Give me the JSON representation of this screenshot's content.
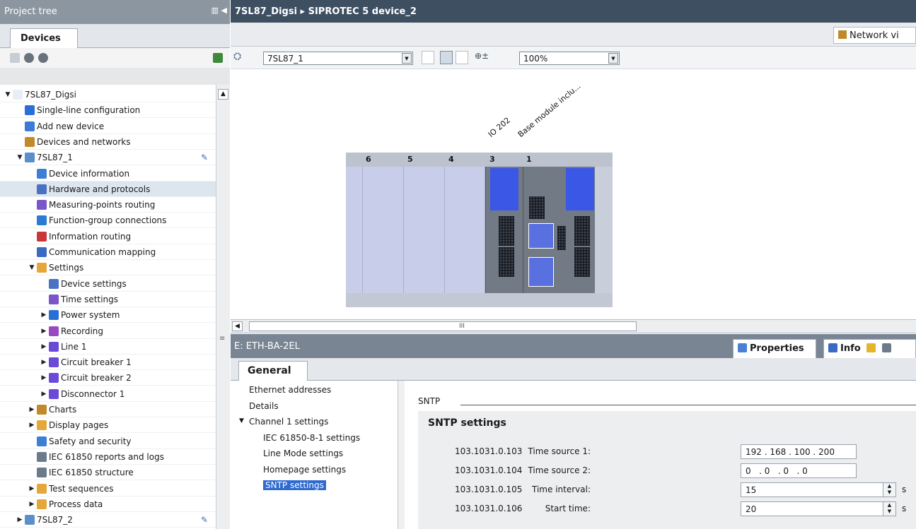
{
  "project_tree": {
    "title": "Project tree",
    "tab": "Devices",
    "items": [
      {
        "label": "7SL87_Digsi",
        "arrow": "▼",
        "indent": 0,
        "icon_color": "#e8eef5"
      },
      {
        "label": "Single-line configuration",
        "arrow": "",
        "indent": 1,
        "icon_color": "#2a6fd6"
      },
      {
        "label": "Add new device",
        "arrow": "",
        "indent": 1,
        "icon_color": "#3a7bd5"
      },
      {
        "label": "Devices and networks",
        "arrow": "",
        "indent": 1,
        "icon_color": "#c08a2a"
      },
      {
        "label": "7SL87_1",
        "arrow": "▼",
        "indent": 1,
        "icon_color": "#5b8fc9",
        "pencil": true
      },
      {
        "label": "Device information",
        "arrow": "",
        "indent": 2,
        "icon_color": "#3e7fd6"
      },
      {
        "label": "Hardware and protocols",
        "arrow": "",
        "indent": 2,
        "icon_color": "#4a72c2",
        "highlight": true
      },
      {
        "label": "Measuring-points routing",
        "arrow": "",
        "indent": 2,
        "icon_color": "#7a56c9"
      },
      {
        "label": "Function-group connections",
        "arrow": "",
        "indent": 2,
        "icon_color": "#2a7bd6"
      },
      {
        "label": "Information routing",
        "arrow": "",
        "indent": 2,
        "icon_color": "#c8383b"
      },
      {
        "label": "Communication mapping",
        "arrow": "",
        "indent": 2,
        "icon_color": "#3a6ac2"
      },
      {
        "label": "Settings",
        "arrow": "▼",
        "indent": 2,
        "icon_color": "#e6a73a"
      },
      {
        "label": "Device settings",
        "arrow": "",
        "indent": 3,
        "icon_color": "#4a72c2"
      },
      {
        "label": "Time settings",
        "arrow": "",
        "indent": 3,
        "icon_color": "#7a56c9"
      },
      {
        "label": "Power system",
        "arrow": "▶",
        "indent": 3,
        "icon_color": "#2a6fd6"
      },
      {
        "label": "Recording",
        "arrow": "▶",
        "indent": 3,
        "icon_color": "#9a4ac0"
      },
      {
        "label": "Line 1",
        "arrow": "▶",
        "indent": 3,
        "icon_color": "#6a4ad6"
      },
      {
        "label": "Circuit breaker 1",
        "arrow": "▶",
        "indent": 3,
        "icon_color": "#6a4ad6"
      },
      {
        "label": "Circuit breaker 2",
        "arrow": "▶",
        "indent": 3,
        "icon_color": "#6a4ad6"
      },
      {
        "label": "Disconnector 1",
        "arrow": "▶",
        "indent": 3,
        "icon_color": "#6a4ad6"
      },
      {
        "label": "Charts",
        "arrow": "▶",
        "indent": 2,
        "icon_color": "#c08a2a"
      },
      {
        "label": "Display pages",
        "arrow": "▶",
        "indent": 2,
        "icon_color": "#e6a73a"
      },
      {
        "label": "Safety and security",
        "arrow": "",
        "indent": 2,
        "icon_color": "#3e7fd6"
      },
      {
        "label": "IEC 61850 reports and logs",
        "arrow": "",
        "indent": 2,
        "icon_color": "#6b7b8c"
      },
      {
        "label": "IEC 61850 structure",
        "arrow": "",
        "indent": 2,
        "icon_color": "#6b7b8c"
      },
      {
        "label": "Test sequences",
        "arrow": "▶",
        "indent": 2,
        "icon_color": "#e6a73a"
      },
      {
        "label": "Process data",
        "arrow": "▶",
        "indent": 2,
        "icon_color": "#e6a73a"
      },
      {
        "label": "7SL87_2",
        "arrow": "▶",
        "indent": 1,
        "icon_color": "#5b8fc9",
        "pencil": true
      }
    ]
  },
  "editor": {
    "breadcrumb": "7SL87_Digsi ▸ SIPROTEC 5 device_2",
    "network_view_label": "Network vi",
    "device_select": "7SL87_1",
    "zoom": "100%",
    "module_labels": [
      "IO 202",
      "Base module inclu..."
    ],
    "slot_numbers": [
      "6",
      "5",
      "4",
      "3",
      "1"
    ]
  },
  "inspector": {
    "title": "E: ETH-BA-2EL",
    "properties_tab": "Properties",
    "info_tab": "Info",
    "general_tab": "General",
    "nav": [
      {
        "label": "Ethernet addresses",
        "level": 0
      },
      {
        "label": "Details",
        "level": 0
      },
      {
        "label": "Channel 1 settings",
        "level": 0,
        "expanded": true
      },
      {
        "label": "IEC 61850-8-1 settings",
        "level": 1
      },
      {
        "label": "Line Mode settings",
        "level": 1
      },
      {
        "label": "Homepage settings",
        "level": 1
      },
      {
        "label": "SNTP settings",
        "level": 1,
        "selected": true
      }
    ],
    "section_title": "SNTP",
    "group_title": "SNTP settings",
    "params": [
      {
        "id": "103.1031.0.103",
        "label": "Time source 1:",
        "value": "192 . 168 . 100 . 200",
        "unit": "",
        "spin": false
      },
      {
        "id": "103.1031.0.104",
        "label": "Time source 2:",
        "value": "0   . 0   . 0   . 0",
        "unit": "",
        "spin": false
      },
      {
        "id": "103.1031.0.105",
        "label": "Time interval:",
        "value": "15",
        "unit": "s",
        "spin": true
      },
      {
        "id": "103.1031.0.106",
        "label": "Start time:",
        "value": "20",
        "unit": "s",
        "spin": true
      }
    ]
  }
}
